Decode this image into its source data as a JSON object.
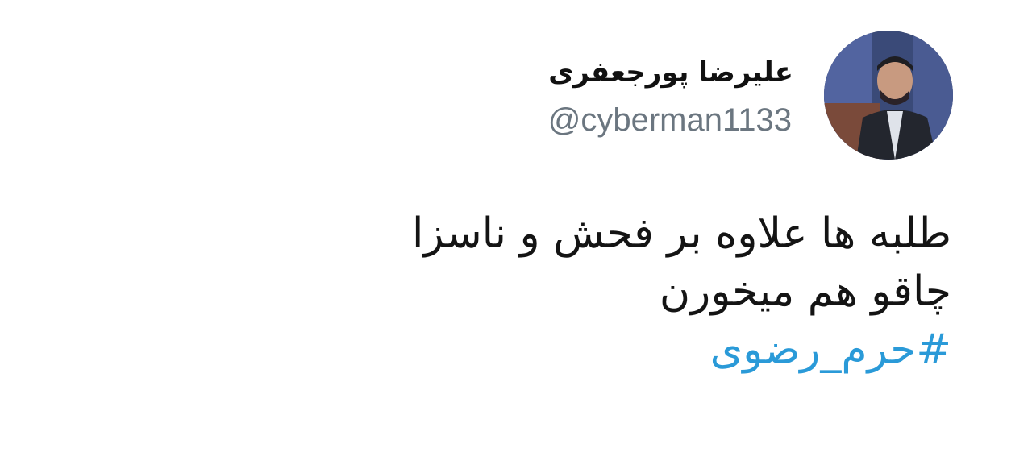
{
  "author": {
    "display_name": "علیرضا پورجعفری",
    "handle": "@cyberman1133",
    "avatar_icon": "profile-photo"
  },
  "tweet": {
    "lines": [
      "طلبه ها علاوه بر فحش و ناسزا",
      "چاقو هم میخورن"
    ],
    "hashtag": "#حرم_رضوی"
  },
  "colors": {
    "text": "#141414",
    "handle": "#6b7680",
    "hashtag": "#2a9ad8",
    "background": "#ffffff"
  }
}
